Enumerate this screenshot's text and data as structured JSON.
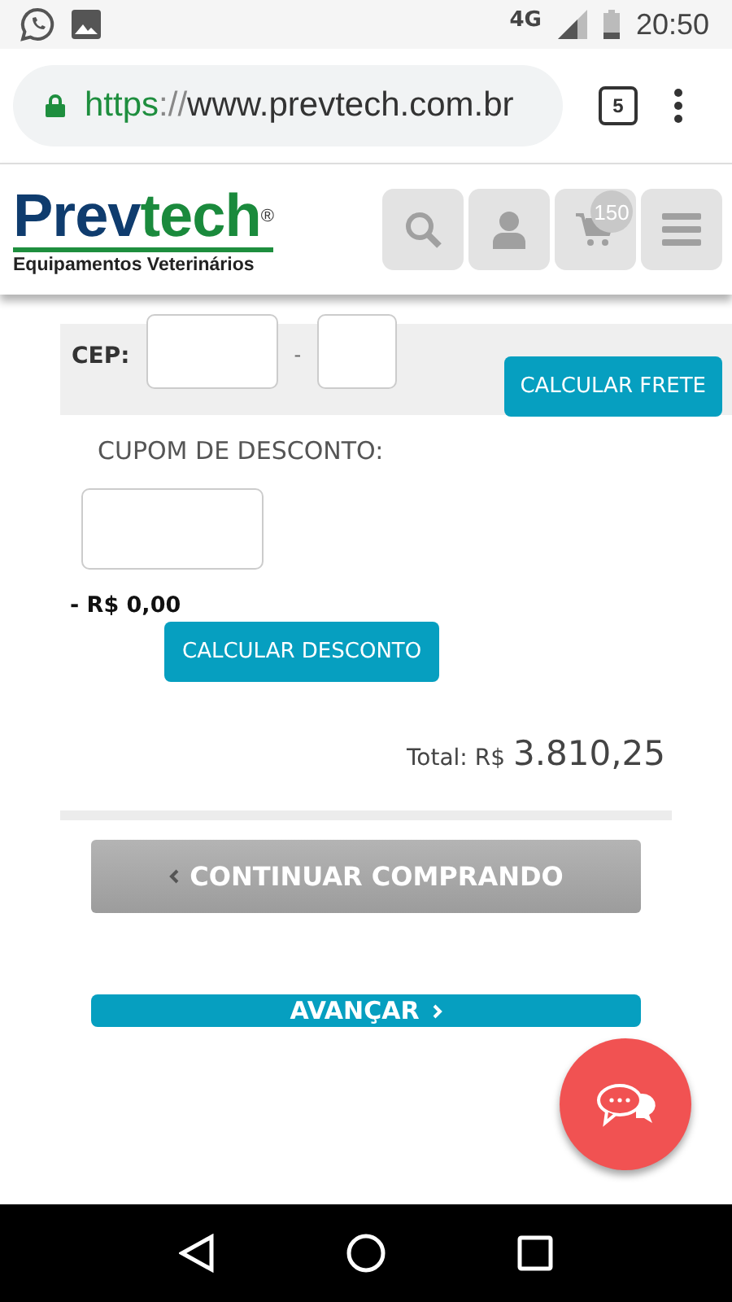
{
  "status_bar": {
    "network": "4G",
    "time": "20:50"
  },
  "browser": {
    "url_scheme": "https",
    "url_separator": "://",
    "url_rest": "www.prevtech.com.br",
    "tab_count": "5"
  },
  "header": {
    "logo_start": "Prev",
    "logo_end": "tech",
    "logo_mark": "®",
    "tagline": "Equipamentos Veterinários",
    "cart_count": "150"
  },
  "shipping": {
    "label": "CEP:",
    "separator": "-",
    "button": "CALCULAR FRETE"
  },
  "coupon": {
    "label": "CUPOM DE DESCONTO:",
    "discount": "- R$ 0,00",
    "button": "CALCULAR DESCONTO"
  },
  "total": {
    "label": "Total: R$",
    "value": "3.810,25"
  },
  "actions": {
    "continue": "CONTINUAR COMPRANDO",
    "next": "AVANÇAR"
  }
}
